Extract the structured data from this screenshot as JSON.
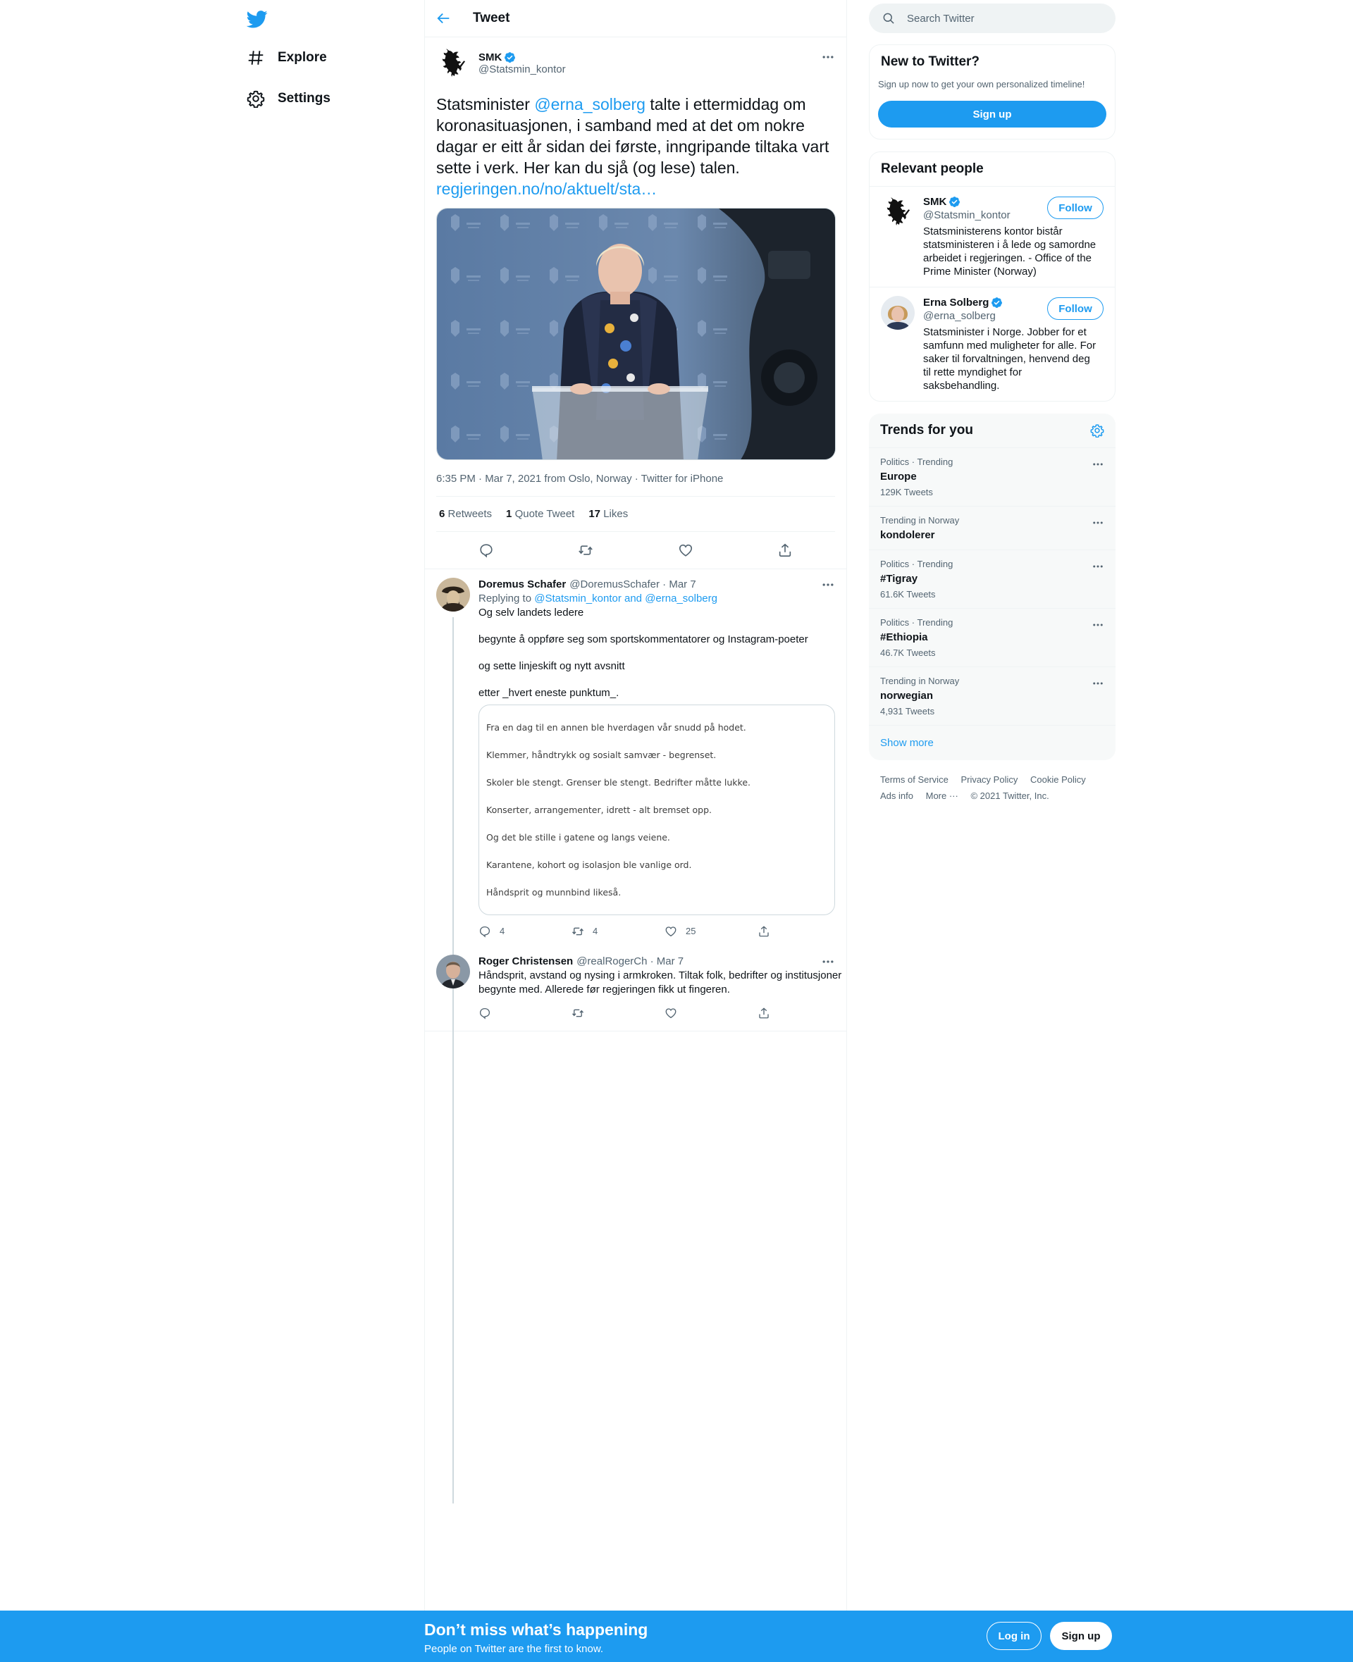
{
  "nav": {
    "explore": "Explore",
    "settings": "Settings"
  },
  "header": {
    "title": "Tweet"
  },
  "tweet": {
    "author_name": "SMK",
    "author_handle": "@Statsmin_kontor",
    "text_before": "Statsminister ",
    "mention": "@erna_solberg",
    "text_after": " talte i ettermiddag om koronasituasjonen, i samband med at det om nokre dagar er eitt år sidan dei første, inngripande tiltaka vart sette i verk. Her kan du sjå (og lese) talen.",
    "link": "regjeringen.no/no/aktuelt/sta…",
    "meta": "6:35 PM · Mar 7, 2021 from Oslo, Norway · Twitter for iPhone",
    "retweets": "6",
    "retweets_label": "Retweets",
    "quotes": "1",
    "quotes_label": "Quote Tweet",
    "likes": "17",
    "likes_label": "Likes"
  },
  "replies": [
    {
      "name": "Doremus Schafer",
      "handle_date": "@DoremusSchafer · Mar 7",
      "replying_prefix": "Replying to",
      "replying_to": "@Statsmin_kontor and @erna_solberg",
      "lines": [
        "Og selv landets ledere",
        "begynte å oppføre seg som sportskommentatorer og Instagram-poeter",
        "og sette linjeskift og nytt avsnitt",
        "etter _hvert eneste punktum_."
      ],
      "quote_lines": [
        "Fra en dag til en annen ble hverdagen vår snudd på hodet.",
        "Klemmer, håndtrykk og sosialt samvær - begrenset.",
        "Skoler ble stengt. Grenser ble stengt. Bedrifter måtte lukke.",
        "Konserter, arrangementer, idrett - alt bremset opp.",
        "Og det ble stille i gatene og langs veiene.",
        "Karantene, kohort og isolasjon ble vanlige ord.",
        "Håndsprit og munnbind likeså."
      ],
      "reply_count": "4",
      "retweet_count": "4",
      "like_count": "25"
    },
    {
      "name": "Roger Christensen",
      "handle_date": "@realRogerCh · Mar 7",
      "text": "Håndsprit, avstand og nysing i armkroken. Tiltak folk, bedrifter og institusjoner begynte med. Allerede før regjeringen fikk ut fingeren."
    }
  ],
  "sidebar": {
    "search_placeholder": "Search Twitter",
    "new_title": "New to Twitter?",
    "new_sub": "Sign up now to get your own personalized timeline!",
    "signup": "Sign up",
    "relevant_title": "Relevant people",
    "people": [
      {
        "name": "SMK",
        "handle": "@Statsmin_kontor",
        "bio": "Statsministerens kontor bistår statsministeren i å lede og samordne arbeidet i regjeringen. - Office of the Prime Minister (Norway)",
        "follow": "Follow"
      },
      {
        "name": "Erna Solberg",
        "handle": "@erna_solberg",
        "bio": "Statsminister i Norge. Jobber for et samfunn med muligheter for alle. For saker til forvaltningen, henvend deg til rette myndighet for saksbehandling.",
        "follow": "Follow"
      }
    ],
    "trends_title": "Trends for you",
    "trends": [
      {
        "context": "Politics · Trending",
        "name": "Europe",
        "count": "129K Tweets"
      },
      {
        "context": "Trending in Norway",
        "name": "kondolerer",
        "count": ""
      },
      {
        "context": "Politics · Trending",
        "name": "#Tigray",
        "count": "61.6K Tweets"
      },
      {
        "context": "Politics · Trending",
        "name": "#Ethiopia",
        "count": "46.7K Tweets"
      },
      {
        "context": "Trending in Norway",
        "name": "norwegian",
        "count": "4,931 Tweets"
      }
    ],
    "show_more": "Show more",
    "footer": [
      "Terms of Service",
      "Privacy Policy",
      "Cookie Policy",
      "Ads info",
      "More ···",
      "© 2021 Twitter, Inc."
    ]
  },
  "bottom": {
    "title": "Don’t miss what’s happening",
    "subtitle": "People on Twitter are the first to know.",
    "login": "Log in",
    "signup": "Sign up"
  },
  "colors": {
    "accent": "#1d9bf0",
    "text": "#0f1419",
    "muted": "#536471"
  },
  "icons": [
    "twitter-logo-icon",
    "hashtag-icon",
    "gear-icon",
    "back-arrow-icon",
    "verified-icon",
    "more-icon",
    "reply-icon",
    "retweet-icon",
    "like-icon",
    "share-icon",
    "search-icon"
  ]
}
